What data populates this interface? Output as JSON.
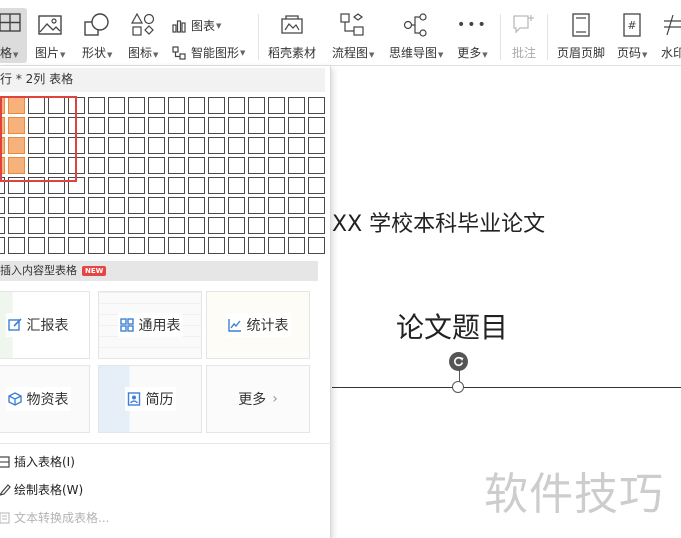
{
  "ribbon": {
    "table_label": "格",
    "picture_label": "图片",
    "shape_label": "形状",
    "icon_label": "图标",
    "chart_label": "图表",
    "smartart_label": "智能图形",
    "stock_label": "稻壳素材",
    "flowchart_label": "流程图",
    "mindmap_label": "思维导图",
    "more_label": "更多",
    "comment_label": "批注",
    "header_footer_label": "页眉页脚",
    "page_number_label": "页码",
    "watermark_label": "水印"
  },
  "panel": {
    "grid_status": "行 * 2列 表格",
    "grid_rows": 8,
    "grid_cols": 17,
    "selected_rows": 4,
    "selected_cols": 2,
    "section_title": "插入内容型表格",
    "new_badge": "NEW",
    "cards": [
      {
        "label": "汇报表",
        "icon": "edit-report-icon"
      },
      {
        "label": "通用表",
        "icon": "grid-table-icon"
      },
      {
        "label": "统计表",
        "icon": "line-chart-icon"
      },
      {
        "label": "物资表",
        "icon": "cube-icon"
      },
      {
        "label": "简历",
        "icon": "resume-icon"
      },
      {
        "label": "更多",
        "icon": "chevron-right-icon"
      }
    ],
    "menu": {
      "insert_table": "插入表格(I)",
      "draw_table": "绘制表格(W)",
      "text_to_table": "文本转换成表格..."
    }
  },
  "document": {
    "university": "XX 学校本科毕业论文",
    "thesis_title": "论文题目"
  },
  "watermark": "软件技巧",
  "colors": {
    "selected_cell": "#f6b27a",
    "highlight_box": "#e0433d",
    "new_badge": "#e54545",
    "icon_blue": "#3d7fd6"
  }
}
